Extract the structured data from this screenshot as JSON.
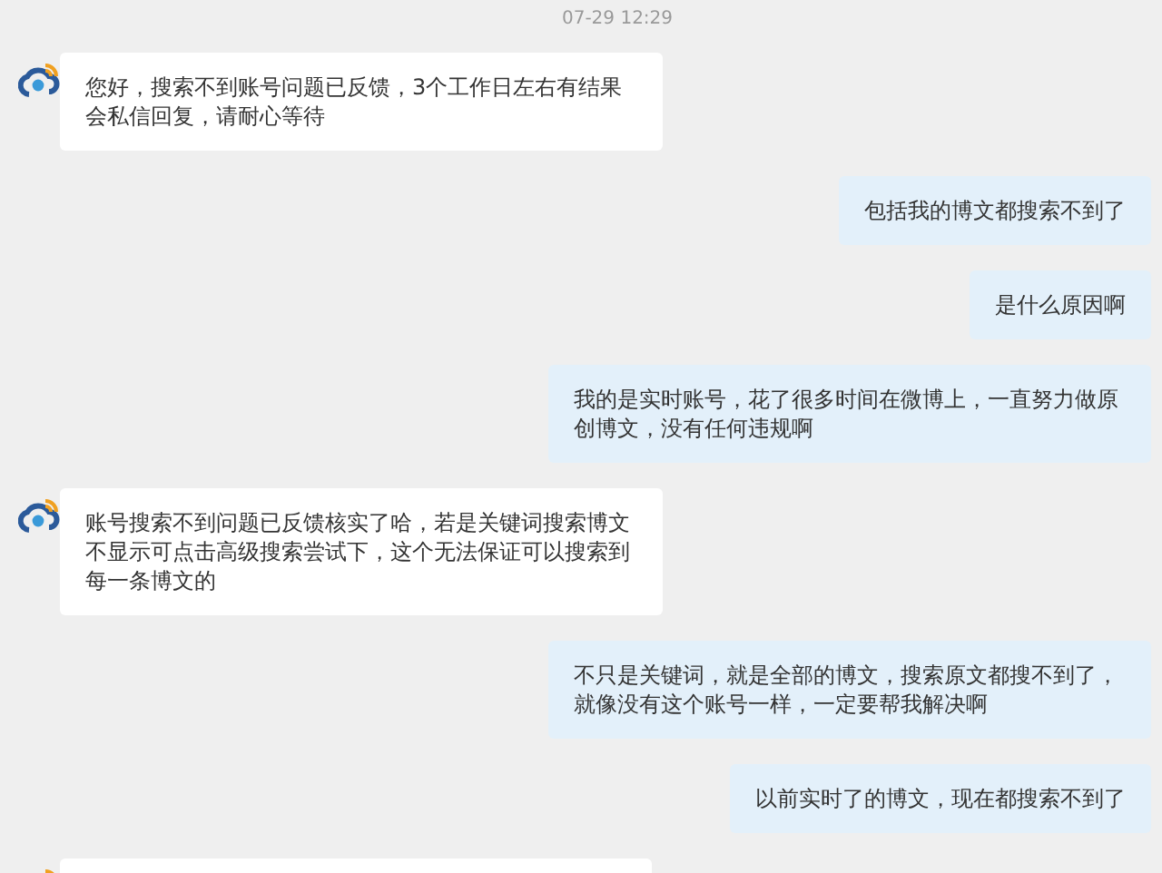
{
  "timestamp": "07-29 12:29",
  "messages": [
    {
      "kind": "left",
      "text": "您好，搜索不到账号问题已反馈，3个工作日左右有结果会私信回复，请耐心等待"
    },
    {
      "kind": "right",
      "text": "包括我的博文都搜索不到了"
    },
    {
      "kind": "right",
      "text": "是什么原因啊"
    },
    {
      "kind": "right",
      "text": "我的是实时账号，花了很多时间在微博上，一直努力做原创博文，没有任何违规啊"
    },
    {
      "kind": "left",
      "text": "账号搜索不到问题已反馈核实了哈，若是关键词搜索博文不显示可点击高级搜索尝试下，这个无法保证可以搜索到每一条博文的"
    },
    {
      "kind": "right",
      "text": "不只是关键词，就是全部的博文，搜索原文都搜不到了，就像没有这个账号一样，一定要帮我解决啊"
    },
    {
      "kind": "right",
      "text": "以前实时了的博文，现在都搜索不到了"
    },
    {
      "kind": "left"
    }
  ]
}
